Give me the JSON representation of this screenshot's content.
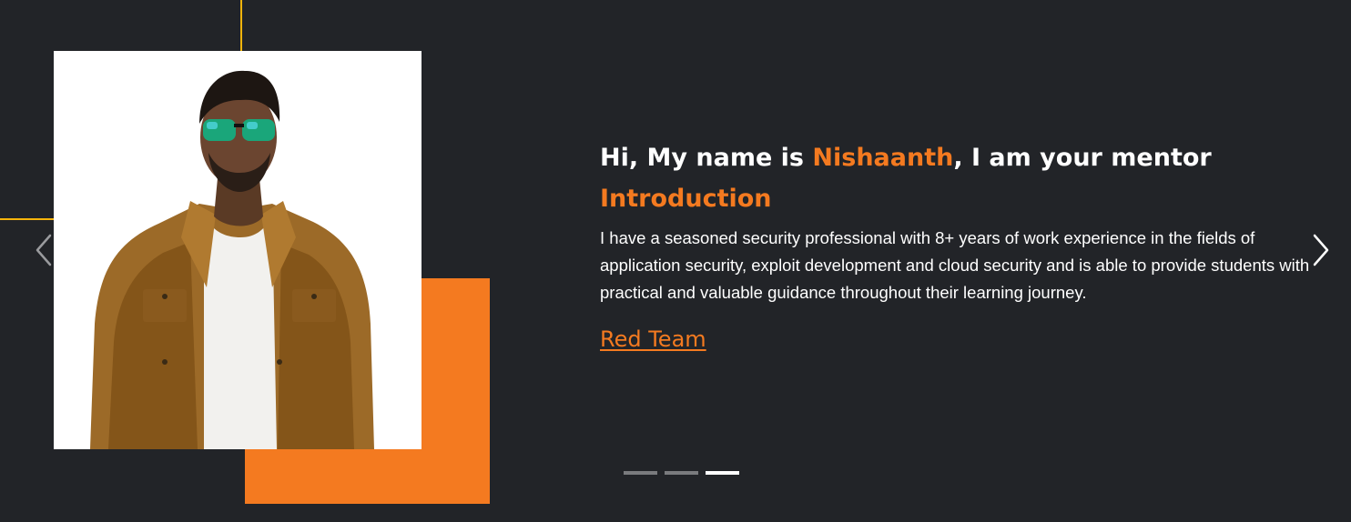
{
  "mentor": {
    "heading_prefix": "Hi, My name is ",
    "name": "Nishaanth",
    "heading_suffix": ", I am your mentor",
    "subheading": "Introduction",
    "bio": "I have a seasoned security professional with 8+ years of work experience in the fields of application security, exploit development and cloud security and is able to provide students with practical and valuable guidance throughout their learning journey.",
    "link_label": "Red Team"
  },
  "carousel": {
    "slide_count": 3,
    "active_index": 2
  },
  "colors": {
    "background": "#222428",
    "accent": "#f47a20",
    "frame_yellow": "#f5b40b",
    "text": "#ffffff",
    "indicator_inactive": "#7a7b7e",
    "indicator_active": "#ffffff"
  },
  "icons": {
    "prev": "chevron-left-icon",
    "next": "chevron-right-icon"
  }
}
